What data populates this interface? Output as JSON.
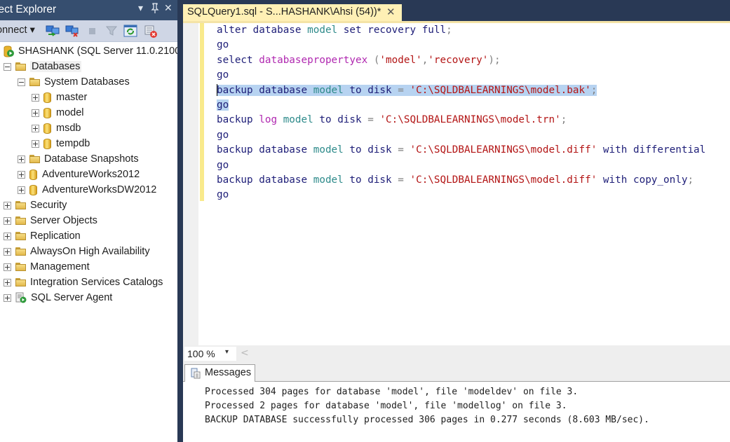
{
  "object_explorer": {
    "title": "ject Explorer",
    "controls": {
      "dropdown": "▾",
      "pin": "ᛘ",
      "close": "✕"
    },
    "toolbar": {
      "connect_label": "onnect ▾",
      "icons": [
        "connect-object-explorer-icon",
        "disconnect-icon",
        "stop-icon",
        "filter-icon",
        "refresh-icon",
        "remove-filter-icon"
      ]
    },
    "tree": [
      {
        "label": "SHASHANK (SQL Server 11.0.2100",
        "icon": "server-icon",
        "expander": "none",
        "level": 0
      },
      {
        "label": "Databases",
        "icon": "folder-icon",
        "expander": "minus",
        "level": 0
      },
      {
        "label": "System Databases",
        "icon": "folder-icon",
        "expander": "minus",
        "level": 1
      },
      {
        "label": "master",
        "icon": "database-icon",
        "expander": "plus",
        "level": 2
      },
      {
        "label": "model",
        "icon": "database-icon",
        "expander": "plus",
        "level": 2
      },
      {
        "label": "msdb",
        "icon": "database-icon",
        "expander": "plus",
        "level": 2
      },
      {
        "label": "tempdb",
        "icon": "database-icon",
        "expander": "plus",
        "level": 2
      },
      {
        "label": "Database Snapshots",
        "icon": "folder-icon",
        "expander": "plus",
        "level": 1
      },
      {
        "label": "AdventureWorks2012",
        "icon": "database-icon",
        "expander": "plus",
        "level": 1
      },
      {
        "label": "AdventureWorksDW2012",
        "icon": "database-icon",
        "expander": "plus",
        "level": 1
      },
      {
        "label": "Security",
        "icon": "folder-icon",
        "expander": "plus",
        "level": 0
      },
      {
        "label": "Server Objects",
        "icon": "folder-icon",
        "expander": "plus",
        "level": 0
      },
      {
        "label": "Replication",
        "icon": "folder-icon",
        "expander": "plus",
        "level": 0
      },
      {
        "label": "AlwaysOn High Availability",
        "icon": "folder-icon",
        "expander": "plus",
        "level": 0
      },
      {
        "label": "Management",
        "icon": "folder-icon",
        "expander": "plus",
        "level": 0
      },
      {
        "label": "Integration Services Catalogs",
        "icon": "folder-icon",
        "expander": "plus",
        "level": 0
      },
      {
        "label": "SQL Server Agent",
        "icon": "sql-agent-icon",
        "expander": "plus",
        "level": 0
      }
    ]
  },
  "editor": {
    "tab": {
      "label": "SQLQuery1.sql - S...HASHANK\\Ahsi (54))*",
      "close": "✕"
    },
    "lines": [
      {
        "tokens": [
          [
            "kw",
            "alter "
          ],
          [
            "kw",
            "database "
          ],
          [
            "id",
            "model "
          ],
          [
            "kw",
            "set "
          ],
          [
            "kw",
            "recovery "
          ],
          [
            "kw",
            "full"
          ],
          [
            "op",
            ";"
          ]
        ],
        "selected": false
      },
      {
        "tokens": [
          [
            "kw",
            "go"
          ]
        ],
        "selected": false
      },
      {
        "tokens": [
          [
            "kw",
            "select "
          ],
          [
            "fn",
            "databasepropertyex "
          ],
          [
            "op",
            "("
          ],
          [
            "str",
            "'model'"
          ],
          [
            "op",
            ","
          ],
          [
            "str",
            "'recovery'"
          ],
          [
            "op",
            ");"
          ]
        ],
        "selected": false
      },
      {
        "tokens": [
          [
            "kw",
            "go"
          ]
        ],
        "selected": false
      },
      {
        "tokens": [
          [
            "kw",
            "backup "
          ],
          [
            "kw",
            "database "
          ],
          [
            "id",
            "model "
          ],
          [
            "kw",
            "to "
          ],
          [
            "kw",
            "disk "
          ],
          [
            "op",
            "= "
          ],
          [
            "str",
            "'C:\\SQLDBALEARNINGS\\model.bak'"
          ],
          [
            "op",
            ";"
          ]
        ],
        "selected": true,
        "caret": true
      },
      {
        "tokens": [
          [
            "kw",
            "go"
          ]
        ],
        "selected": true
      },
      {
        "tokens": [
          [
            "kw",
            "backup "
          ],
          [
            "fn",
            "log "
          ],
          [
            "id",
            "model "
          ],
          [
            "kw",
            "to "
          ],
          [
            "kw",
            "disk "
          ],
          [
            "op",
            "= "
          ],
          [
            "str",
            "'C:\\SQLDBALEARNINGS\\model.trn'"
          ],
          [
            "op",
            ";"
          ]
        ],
        "selected": false
      },
      {
        "tokens": [
          [
            "kw",
            "go"
          ]
        ],
        "selected": false
      },
      {
        "tokens": [
          [
            "kw",
            "backup "
          ],
          [
            "kw",
            "database "
          ],
          [
            "id",
            "model "
          ],
          [
            "kw",
            "to "
          ],
          [
            "kw",
            "disk "
          ],
          [
            "op",
            "= "
          ],
          [
            "str",
            "'C:\\SQLDBALEARNINGS\\model.diff'"
          ],
          [
            "kw",
            " with "
          ],
          [
            "kw",
            "differential"
          ]
        ],
        "selected": false
      },
      {
        "tokens": [
          [
            "kw",
            "go"
          ]
        ],
        "selected": false
      },
      {
        "tokens": [
          [
            "kw",
            "backup "
          ],
          [
            "kw",
            "database "
          ],
          [
            "id",
            "model "
          ],
          [
            "kw",
            "to "
          ],
          [
            "kw",
            "disk "
          ],
          [
            "op",
            "= "
          ],
          [
            "str",
            "'C:\\SQLDBALEARNINGS\\model.diff'"
          ],
          [
            "kw",
            " with "
          ],
          [
            "kw",
            "copy_only"
          ],
          [
            "op",
            ";"
          ]
        ],
        "selected": false
      },
      {
        "tokens": [
          [
            "kw",
            "go"
          ]
        ],
        "selected": false
      }
    ],
    "zoom": {
      "value": "100 %",
      "arrow": "▾",
      "scroll_left": "<"
    }
  },
  "results": {
    "tab_label": "Messages",
    "messages": [
      "Processed 304 pages for database 'model', file 'modeldev' on file 3.",
      "Processed 2 pages for database 'model', file 'modellog' on file 3.",
      "BACKUP DATABASE successfully processed 306 pages in 0.277 seconds (8.603 MB/sec)."
    ]
  },
  "colors": {
    "chrome_dark": "#293955",
    "tab_active": "#fff0b5",
    "keyword": "#1e1e78",
    "identifier": "#2d8a8a",
    "function": "#b028b0",
    "string": "#b31515",
    "selection": "#b7d3f1"
  }
}
